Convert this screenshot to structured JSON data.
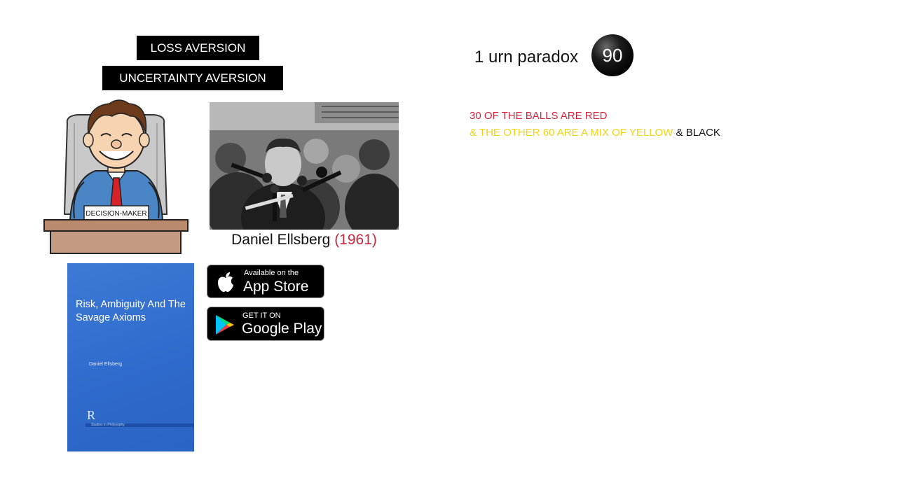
{
  "labels": {
    "loss_aversion": "LOSS AVERSION",
    "uncertainty_aversion": "UNCERTAINTY AVERSION"
  },
  "cartoon": {
    "nameplate": "DECISION-MAKER"
  },
  "photo": {
    "caption_name": "Daniel Ellsberg",
    "caption_year": "(1961)"
  },
  "book": {
    "title": "Risk, Ambiguity And The Savage Axioms",
    "author": "Daniel Ellsberg",
    "publisher_mark": "R",
    "series": "Studies in Philosophy"
  },
  "badges": {
    "appstore_small": "Available on the",
    "appstore_big": "App Store",
    "googleplay_small": "GET IT ON",
    "googleplay_big": "Google Play"
  },
  "paradox": {
    "title": "1 urn paradox",
    "ball_number": "90",
    "line1": "30 OF THE BALLS ARE RED",
    "line2_yellow": "& THE OTHER 60 ARE A MIX OF YELLOW",
    "line2_black": "& BLACK"
  },
  "colors": {
    "red_text": "#d4273f",
    "yellow_text": "#f0d414",
    "book_blue": "#2f6bcc"
  }
}
